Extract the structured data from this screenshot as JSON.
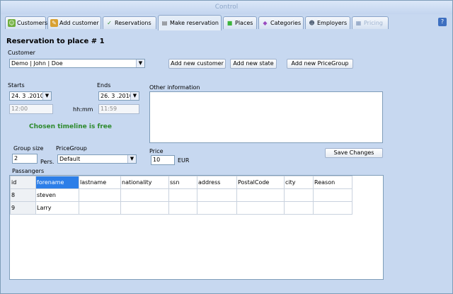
{
  "window": {
    "title": "Control"
  },
  "tabs": [
    {
      "label": "Customers",
      "icon": "customers-icon",
      "glyph": "☺"
    },
    {
      "label": "Add customer",
      "icon": "add-customer-icon",
      "glyph": "✎"
    },
    {
      "label": "Reservations",
      "icon": "checkmark-icon",
      "glyph": "✓"
    },
    {
      "label": "Make reservation",
      "icon": "make-reservation-icon",
      "glyph": "▤"
    },
    {
      "label": "Places",
      "icon": "places-icon",
      "glyph": "■"
    },
    {
      "label": "Categories",
      "icon": "categories-icon",
      "glyph": "◆"
    },
    {
      "label": "Employers",
      "icon": "employers-icon",
      "glyph": "☻"
    },
    {
      "label": "Pricing",
      "icon": "pricing-icon",
      "glyph": "▦"
    }
  ],
  "help_label": "?",
  "form": {
    "heading": "Reservation to place #  1",
    "customer_label": "Customer",
    "customer_value": "Demo | John | Doe",
    "add_customer_btn": "Add new customer",
    "add_state_btn": "Add new state",
    "add_pricegroup_btn": "Add new PriceGroup",
    "starts_label": "Starts",
    "starts_date": "24. 3 .2010",
    "starts_time": "12:00",
    "hhmm_label": "hh:mm",
    "ends_label": "Ends",
    "ends_date": "26. 3 .2010",
    "ends_time": "11:59",
    "other_info_label": "Other information",
    "timeline_status": "Chosen timeline is free",
    "group_size_label": "Group size",
    "group_size_value": "2",
    "pers_label": "Pers.",
    "pricegroup_label": "PriceGroup",
    "pricegroup_value": "Default",
    "price_label": "Price",
    "price_value": "10",
    "currency": "EUR",
    "save_btn": "Save Changes",
    "passengers_label": "Passangers"
  },
  "grid": {
    "columns": [
      "id",
      "forename",
      "lastname",
      "nationality",
      "ssn",
      "address",
      "PostalCode",
      "city",
      "Reason"
    ],
    "rows": [
      [
        "8",
        "steven",
        "",
        "",
        "",
        "",
        "",
        "",
        ""
      ],
      [
        "9",
        "Larry",
        "",
        "",
        "",
        "",
        "",
        "",
        ""
      ]
    ]
  },
  "colors": {
    "accent": "#2c7ee8",
    "status_free": "#2d8a2d",
    "background": "#c7d8f0"
  }
}
